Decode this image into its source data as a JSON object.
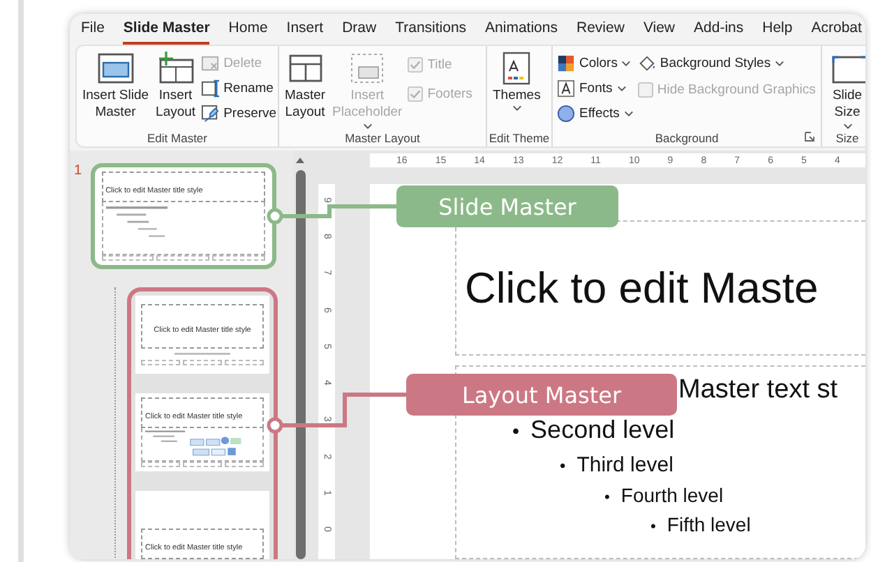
{
  "tabs": [
    {
      "label": "File",
      "selected": false
    },
    {
      "label": "Slide Master",
      "selected": true
    },
    {
      "label": "Home",
      "selected": false
    },
    {
      "label": "Insert",
      "selected": false
    },
    {
      "label": "Draw",
      "selected": false
    },
    {
      "label": "Transitions",
      "selected": false
    },
    {
      "label": "Animations",
      "selected": false
    },
    {
      "label": "Review",
      "selected": false
    },
    {
      "label": "View",
      "selected": false
    },
    {
      "label": "Add-ins",
      "selected": false
    },
    {
      "label": "Help",
      "selected": false
    },
    {
      "label": "Acrobat",
      "selected": false
    }
  ],
  "ribbon": {
    "groups": [
      {
        "label": "Edit Master",
        "columns": [
          [
            {
              "kind": "large",
              "lines": [
                "Insert Slide",
                "Master"
              ],
              "disabled": false
            }
          ],
          [
            {
              "kind": "large",
              "lines": [
                "Insert",
                "Layout"
              ],
              "disabled": false
            }
          ],
          [
            {
              "kind": "small",
              "label": "Delete",
              "disabled": true
            },
            {
              "kind": "small",
              "label": "Rename",
              "disabled": false
            },
            {
              "kind": "small",
              "label": "Preserve",
              "disabled": false
            }
          ]
        ]
      },
      {
        "label": "Master Layout",
        "columns": [
          [
            {
              "kind": "large",
              "lines": [
                "Master",
                "Layout"
              ],
              "disabled": false
            }
          ],
          [
            {
              "kind": "large",
              "lines": [
                "Insert",
                "Placeholder"
              ],
              "disabled": true,
              "dropdown": true
            }
          ],
          [
            {
              "kind": "check",
              "label": "Title",
              "checked": true,
              "disabled": true
            },
            {
              "kind": "check",
              "label": "Footers",
              "checked": true,
              "disabled": true
            }
          ]
        ]
      },
      {
        "label": "Edit Theme",
        "columns": [
          [
            {
              "kind": "large",
              "lines": [
                "Themes"
              ],
              "disabled": false,
              "dropdown": true
            }
          ]
        ]
      },
      {
        "label": "Background",
        "launcher": true,
        "columns": [
          [
            {
              "kind": "small",
              "label": "Colors",
              "disabled": false,
              "dropdown": true
            },
            {
              "kind": "small",
              "label": "Fonts",
              "disabled": false,
              "dropdown": true
            },
            {
              "kind": "small",
              "label": "Effects",
              "disabled": false,
              "dropdown": true
            }
          ],
          [
            {
              "kind": "small",
              "label": "Background Styles",
              "disabled": false,
              "dropdown": true
            },
            {
              "kind": "check",
              "label": "Hide Background Graphics",
              "checked": false,
              "disabled": true
            }
          ]
        ]
      },
      {
        "label": "Size",
        "columns": [
          [
            {
              "kind": "large",
              "lines": [
                "Slide",
                "Size"
              ],
              "disabled": false,
              "dropdown": true
            }
          ]
        ]
      }
    ]
  },
  "thumbnails": {
    "number": "1",
    "master": {
      "title": "Click to edit Master title style",
      "selected": true
    },
    "layouts": [
      {
        "kind": "title_slide",
        "title": "Click to edit Master title style"
      },
      {
        "kind": "content",
        "title": "Click to edit Master title style"
      },
      {
        "kind": "section",
        "title": "Click to edit Master title style"
      }
    ]
  },
  "rulers": {
    "horizontal": [
      "16",
      "15",
      "14",
      "13",
      "12",
      "11",
      "10",
      "9",
      "8",
      "7",
      "6",
      "5",
      "4"
    ],
    "vertical": [
      "9",
      "8",
      "7",
      "6",
      "5",
      "4",
      "3",
      "2",
      "1",
      "0"
    ]
  },
  "slide": {
    "title": "Click to edit Maste",
    "body": [
      {
        "text": "Master text st",
        "children": [
          {
            "bullet": "•",
            "text": "Second level",
            "children": [
              {
                "bullet": "•",
                "text": "Third level",
                "children": [
                  {
                    "bullet": "•",
                    "text": "Fourth level",
                    "children": [
                      {
                        "bullet": "•",
                        "text": "Fifth level"
                      }
                    ]
                  }
                ]
              }
            ]
          }
        ]
      }
    ]
  },
  "callouts": [
    {
      "label": "Slide Master",
      "color": "#8cb989"
    },
    {
      "label": "Layout Master",
      "color": "#cc7884"
    }
  ]
}
